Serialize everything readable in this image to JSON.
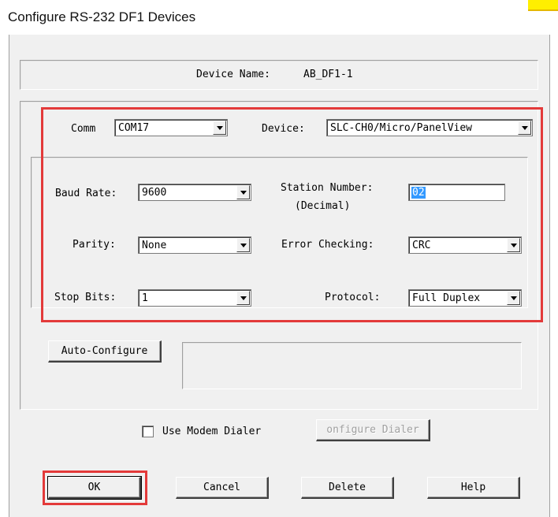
{
  "window": {
    "title": "Configure RS-232 DF1 Devices"
  },
  "device_name": {
    "label": "Device Name:",
    "value": "AB_DF1-1"
  },
  "comm": {
    "label": "Comm",
    "value": "COM17"
  },
  "device": {
    "label": "Device:",
    "value": "SLC-CH0/Micro/PanelView"
  },
  "baud_rate": {
    "label": "Baud Rate:",
    "value": "9600"
  },
  "station_number": {
    "label_line1": "Station Number:",
    "label_line2": "(Decimal)",
    "value": "02"
  },
  "parity": {
    "label": "Parity:",
    "value": "None"
  },
  "error_checking": {
    "label": "Error Checking:",
    "value": "CRC"
  },
  "stop_bits": {
    "label": "Stop Bits:",
    "value": "1"
  },
  "protocol": {
    "label": "Protocol:",
    "value": "Full Duplex"
  },
  "auto_configure": {
    "label": "Auto-Configure",
    "status": ""
  },
  "modem": {
    "checkbox_label": "Use Modem Dialer",
    "checked": false,
    "configure_label": "onfigure Dialer"
  },
  "buttons": {
    "ok": "OK",
    "cancel": "Cancel",
    "delete": "Delete",
    "help": "Help"
  },
  "colors": {
    "highlight_box": "#e33a3a",
    "selection": "#3399ff",
    "dialog_bg": "#f0f0f0",
    "title_accent": "#ffef00"
  }
}
